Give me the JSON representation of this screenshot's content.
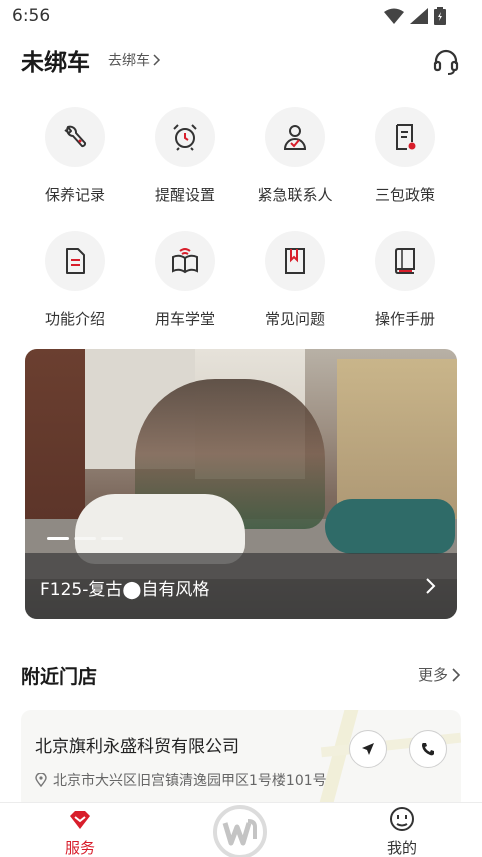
{
  "status_bar": {
    "time": "6:56",
    "icons": [
      "wifi-icon",
      "signal-icon",
      "battery-icon"
    ]
  },
  "header": {
    "title": "未绑车",
    "bind_link": "去绑车",
    "support_icon": "headset-icon"
  },
  "services": [
    {
      "label": "保养记录",
      "icon": "wrench-icon"
    },
    {
      "label": "提醒设置",
      "icon": "alarm-clock-icon"
    },
    {
      "label": "紧急联系人",
      "icon": "contact-icon"
    },
    {
      "label": "三包政策",
      "icon": "policy-doc-icon"
    },
    {
      "label": "功能介绍",
      "icon": "document-icon"
    },
    {
      "label": "用车学堂",
      "icon": "open-book-icon"
    },
    {
      "label": "常见问题",
      "icon": "bookmark-icon"
    },
    {
      "label": "操作手册",
      "icon": "manual-icon"
    }
  ],
  "banner": {
    "caption": "F125-复古⬤自有风格",
    "dot_count": 3,
    "active_dot": 0
  },
  "nearby": {
    "title": "附近门店",
    "more": "更多",
    "store": {
      "name": "北京旗利永盛科贸有限公司",
      "address": "北京市大兴区旧宫镇清逸园甲区1号楼101号"
    }
  },
  "tabbar": {
    "service": "服务",
    "mine": "我的",
    "accent": "#d81e2b"
  }
}
